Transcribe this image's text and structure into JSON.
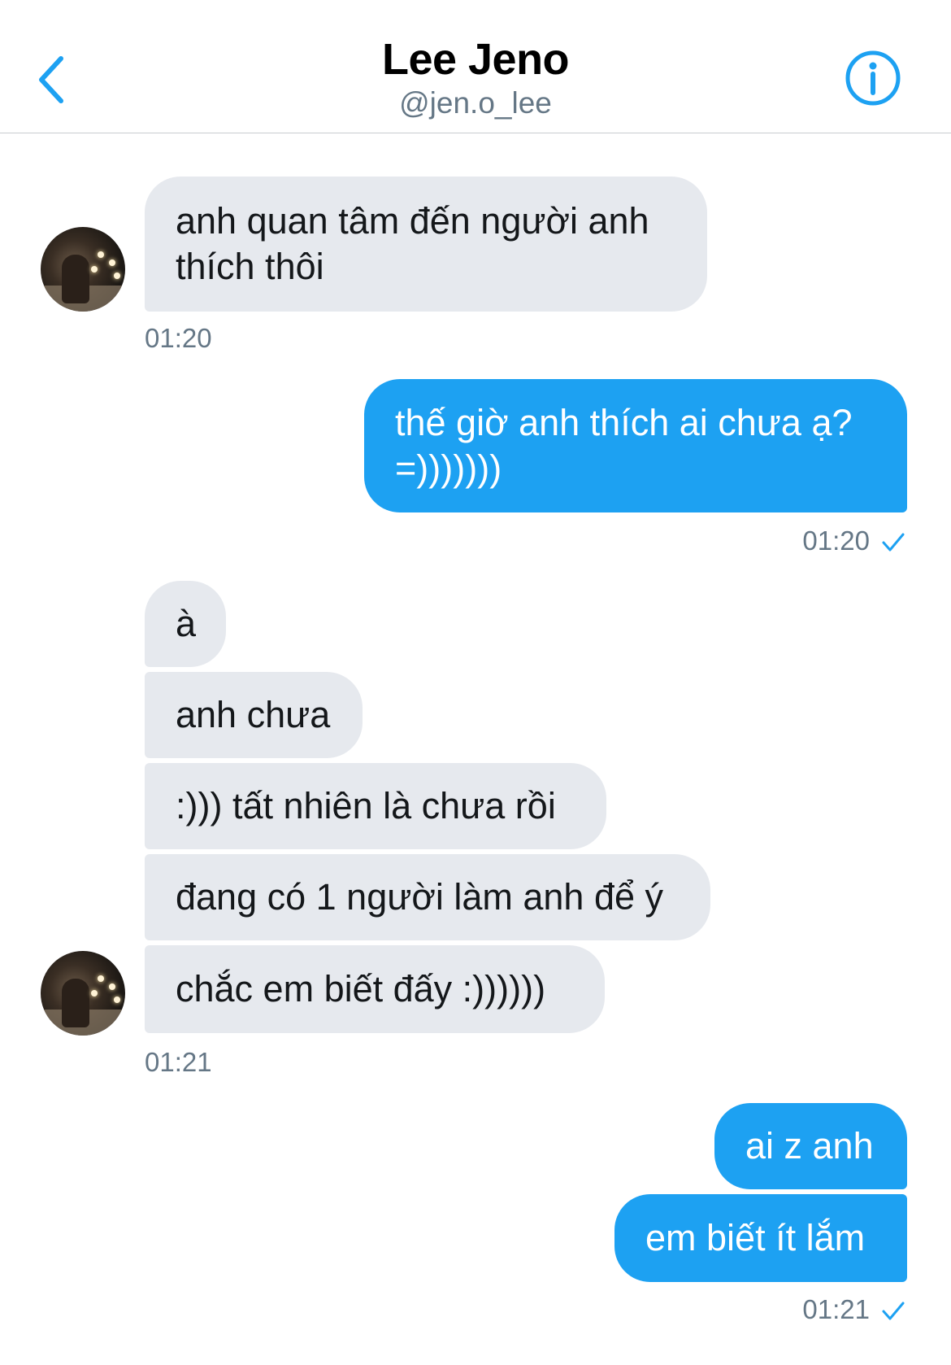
{
  "header": {
    "title": "Lee Jeno",
    "handle": "@jen.o_lee",
    "back_icon": "chevron-left-icon",
    "info_icon": "info-icon"
  },
  "colors": {
    "accent": "#1da1f2",
    "incoming_bubble": "#e6e9ee",
    "timestamp": "#657786"
  },
  "messages": [
    {
      "direction": "in",
      "text": "anh quan tâm đến người anh thích thôi"
    },
    {
      "direction": "in",
      "time": "01:20"
    },
    {
      "direction": "out",
      "text": "thế giờ anh thích ai chưa ạ? =)))))))"
    },
    {
      "direction": "out",
      "time": "01:20"
    },
    {
      "direction": "in",
      "text": "à"
    },
    {
      "direction": "in",
      "text": "anh chưa"
    },
    {
      "direction": "in",
      "text": ":))) tất nhiên là chưa rồi"
    },
    {
      "direction": "in",
      "text": "đang có 1 người làm anh để ý"
    },
    {
      "direction": "in",
      "text": "chắc em biết đấy :))))))"
    },
    {
      "direction": "in",
      "time": "01:21"
    },
    {
      "direction": "out",
      "text": "ai z anh"
    },
    {
      "direction": "out",
      "text": "em biết ít lắm"
    },
    {
      "direction": "out",
      "time": "01:21"
    }
  ]
}
